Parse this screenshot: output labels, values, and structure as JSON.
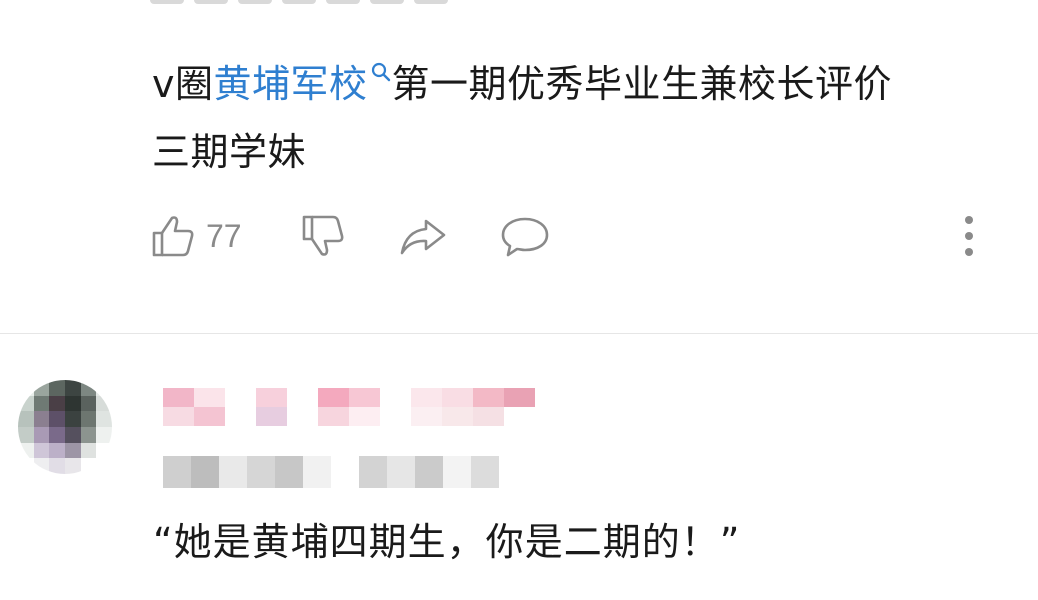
{
  "comment1": {
    "prefix": "v圈",
    "topic": "黄埔军校",
    "suffix": "第一期优秀毕业生兼校长评价",
    "line2": "三期学妹",
    "likes": "77"
  },
  "comment2": {
    "text": "“她是黄埔四期生，你是二期的！”"
  },
  "colors": {
    "topic_link": "#2f7fd0",
    "icon_gray": "#8a8a8a",
    "divider": "#e6e6e6"
  },
  "icons": [
    "thumbs-up-icon",
    "thumbs-down-icon",
    "share-icon",
    "comment-icon",
    "more-icon",
    "search-icon"
  ]
}
